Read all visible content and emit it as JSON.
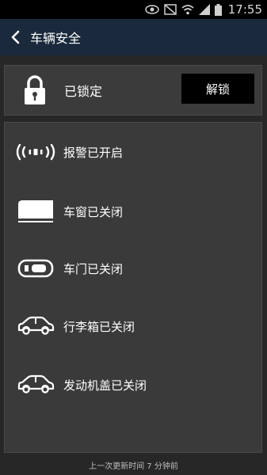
{
  "status_bar": {
    "time": "17:55"
  },
  "app_bar": {
    "title": "车辆安全"
  },
  "lock": {
    "status": "已锁定",
    "button_label": "解锁"
  },
  "statuses": [
    {
      "label": "报警已开启",
      "icon": "alarm-icon"
    },
    {
      "label": "车窗已关闭",
      "icon": "window-icon"
    },
    {
      "label": "车门已关闭",
      "icon": "door-icon"
    },
    {
      "label": "行李箱已关闭",
      "icon": "trunk-car-icon"
    },
    {
      "label": "发动机盖已关闭",
      "icon": "hood-car-icon"
    }
  ],
  "footer": {
    "last_update": "上一次更新时间 7 分钟前"
  }
}
